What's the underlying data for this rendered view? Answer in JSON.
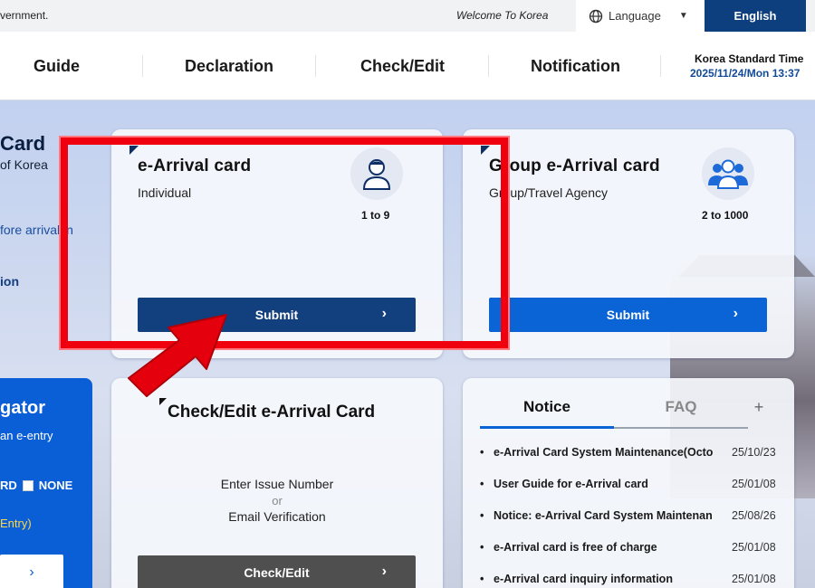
{
  "topbar": {
    "gov_text": "vernment.",
    "welcome": "Welcome To Korea",
    "language_label": "Language",
    "language_icon": "globe-icon",
    "english_button": "English"
  },
  "nav": {
    "items": [
      "Guide",
      "Declaration",
      "Check/Edit",
      "Notification"
    ],
    "clock_label": "Korea Standard Time",
    "clock_value": "2025/11/24/Mon 13:37"
  },
  "left": {
    "title": "Card",
    "subtitle": "of Korea",
    "link": "fore arrival in",
    "bold": "ion",
    "panel": {
      "title": "gator",
      "sub": "an e-entry",
      "row_label_a": "RD",
      "row_label_b": "NONE",
      "yellow": "Entry)",
      "button_chev": "›"
    }
  },
  "individual_card": {
    "title": "e-Arrival card",
    "subtitle": "Individual",
    "range": "1 to 9",
    "icon": "person-icon",
    "submit": "Submit"
  },
  "group_card": {
    "title": "Group e-Arrival card",
    "subtitle": "Group/Travel Agency",
    "range": "2 to 1000",
    "icon": "group-people-icon",
    "submit": "Submit"
  },
  "check_card": {
    "title": "Check/Edit e-Arrival Card",
    "line1": "Enter Issue Number",
    "or": "or",
    "line2": "Email Verification",
    "button": "Check/Edit"
  },
  "notice_card": {
    "tabs": [
      "Notice",
      "FAQ",
      "+"
    ],
    "items": [
      {
        "text": "e-Arrival Card System Maintenance(Octo",
        "date": "25/10/23"
      },
      {
        "text": "User Guide for e-Arrival card",
        "date": "25/01/08"
      },
      {
        "text": "Notice: e-Arrival Card System Maintenan",
        "date": "25/08/26"
      },
      {
        "text": "e-Arrival card is free of charge",
        "date": "25/01/08"
      },
      {
        "text": "e-Arrival card inquiry information",
        "date": "25/01/08"
      }
    ]
  },
  "colors": {
    "navy": "#123f7e",
    "blue": "#0a64d6",
    "highlight_red": "#f0000e"
  }
}
